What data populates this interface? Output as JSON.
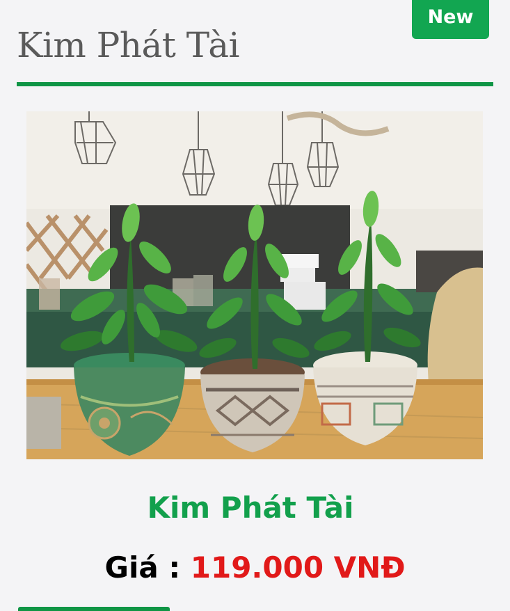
{
  "product": {
    "title": "Kim Phát Tài",
    "badge": "New",
    "name": "Kim Phát Tài",
    "price_label": "Giá : ",
    "price_value": "119.000 VNĐ"
  },
  "image": {
    "subject": "three-potted-zz-plants-photo"
  },
  "colors": {
    "accent": "#12a04c",
    "badge": "#12a651",
    "price": "#e11919",
    "title": "#5a5a5a"
  }
}
